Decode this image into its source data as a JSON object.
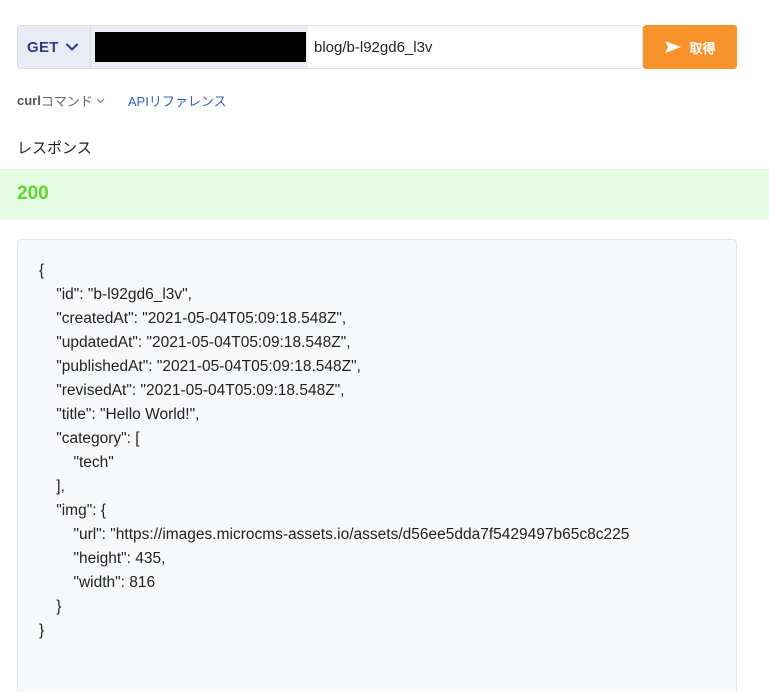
{
  "request": {
    "method": "GET",
    "endpoint": "blog/b-l92gd6_l3v",
    "send_label": "取得"
  },
  "links": {
    "curl_bold": "curl",
    "curl_rest": "コマンド",
    "api_reference": "APIリファレンス"
  },
  "response": {
    "heading": "レスポンス",
    "status": "200",
    "body": "{\n    \"id\": \"b-l92gd6_l3v\",\n    \"createdAt\": \"2021-05-04T05:09:18.548Z\",\n    \"updatedAt\": \"2021-05-04T05:09:18.548Z\",\n    \"publishedAt\": \"2021-05-04T05:09:18.548Z\",\n    \"revisedAt\": \"2021-05-04T05:09:18.548Z\",\n    \"title\": \"Hello World!\",\n    \"category\": [\n        \"tech\"\n    ],\n    \"img\": {\n        \"url\": \"https://images.microcms-assets.io/assets/d56ee5dda7f5429497b65c8c225\n        \"height\": 435,\n        \"width\": 816\n    }\n}"
  },
  "colors": {
    "method": "#2f3a8f",
    "send_button": "#f7922a",
    "status_ok": "#62d62b",
    "status_bg": "#e3fbe3",
    "link": "#2f5fc4"
  },
  "icons": {
    "method_dropdown": "chevron-down-icon",
    "send": "send-icon",
    "curl_dropdown": "small-chevron-icon"
  }
}
